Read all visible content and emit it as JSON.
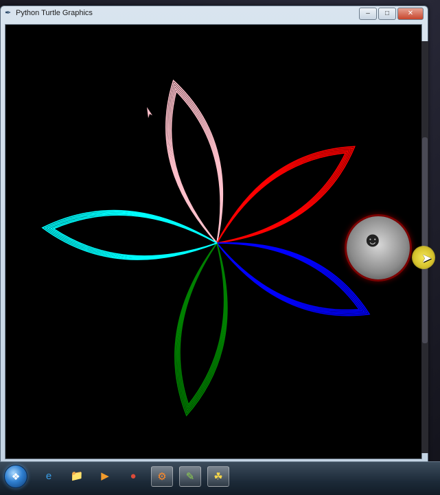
{
  "window": {
    "title": "Python Turtle Graphics",
    "title_icon": "feather-icon",
    "controls": {
      "minimize": "–",
      "maximize": "□",
      "close": "✕"
    }
  },
  "canvas": {
    "background": "#000000",
    "petals": [
      {
        "color": "#ffc0cb",
        "name": "pink"
      },
      {
        "color": "#ff0000",
        "name": "red"
      },
      {
        "color": "#0000ff",
        "name": "blue"
      },
      {
        "color": "#008000",
        "name": "green"
      },
      {
        "color": "#00ffff",
        "name": "cyan"
      }
    ]
  },
  "taskbar": {
    "start_icon": "windows-orb-icon",
    "items": [
      {
        "name": "internet-explorer-icon",
        "glyph": "e",
        "color": "#3a9fe8"
      },
      {
        "name": "file-explorer-icon",
        "glyph": "📁",
        "color": "#f1c75b"
      },
      {
        "name": "media-player-icon",
        "glyph": "▶",
        "color": "#f29b2c"
      },
      {
        "name": "chrome-icon",
        "glyph": "●",
        "color": "#dd4b39"
      },
      {
        "name": "app-icon",
        "glyph": "⚙",
        "color": "#ff8a2a"
      },
      {
        "name": "notepad-icon",
        "glyph": "✎",
        "color": "#8fd14f"
      },
      {
        "name": "python-icon",
        "glyph": "☘",
        "color": "#f5d64a"
      }
    ]
  }
}
